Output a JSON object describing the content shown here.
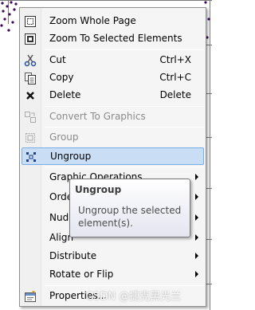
{
  "menu": {
    "items": [
      {
        "label": "Zoom Whole Page",
        "icon": "zoom-page-icon"
      },
      {
        "label": "Zoom To Selected Elements",
        "icon": "zoom-selected-icon"
      },
      {
        "label": "Cut",
        "shortcut": "Ctrl+X",
        "icon": "scissors-icon"
      },
      {
        "label": "Copy",
        "shortcut": "Ctrl+C",
        "icon": "copy-icon"
      },
      {
        "label": "Delete",
        "shortcut": "Delete",
        "icon": "delete-x-icon"
      },
      {
        "label": "Convert To Graphics",
        "icon": "convert-graphics-icon",
        "disabled": true
      },
      {
        "label": "Group",
        "icon": "group-icon",
        "disabled": true
      },
      {
        "label": "Ungroup",
        "icon": "ungroup-icon",
        "highlighted": true
      },
      {
        "label": "Graphic Operations",
        "submenu": true
      },
      {
        "label": "Order",
        "submenu": true
      },
      {
        "label": "Nudge",
        "submenu": true
      },
      {
        "label": "Align",
        "submenu": true
      },
      {
        "label": "Distribute",
        "submenu": true
      },
      {
        "label": "Rotate or Flip",
        "submenu": true
      },
      {
        "label": "Properties...",
        "icon": "properties-icon"
      }
    ]
  },
  "tooltip": {
    "title": "Ungroup",
    "body": "Ungroup the selected element(s)."
  },
  "watermark": "CSDN @捷克黑光兰",
  "colors": {
    "highlight": "#c9def5",
    "highlight_border": "#78aee5",
    "menu_bg": "#f5f5f5"
  }
}
